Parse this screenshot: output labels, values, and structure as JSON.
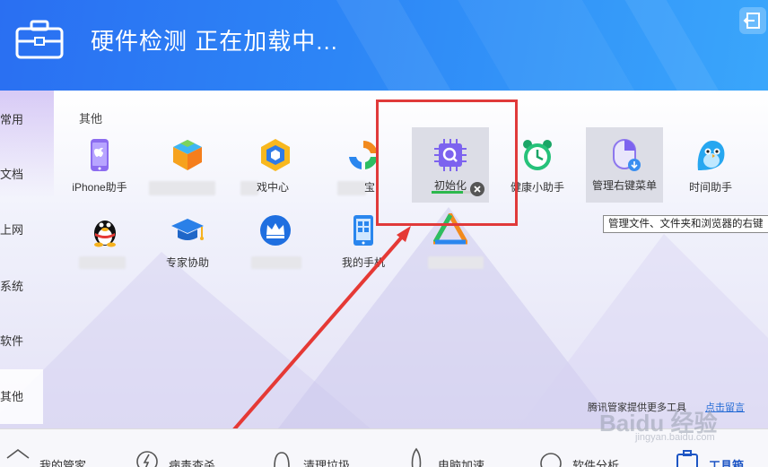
{
  "header": {
    "title": "硬件检测 正在加载中..."
  },
  "sidebar": {
    "items": [
      {
        "label": "常用"
      },
      {
        "label": "文档"
      },
      {
        "label": "上网"
      },
      {
        "label": "系统"
      },
      {
        "label": "软件"
      },
      {
        "label": "其他"
      }
    ]
  },
  "main": {
    "section_title": "其他",
    "tools": [
      {
        "label": "iPhone助手",
        "icon": "iphone-icon"
      },
      {
        "label": "",
        "icon": "cube-icon"
      },
      {
        "label": "戏中心",
        "icon": "game-center-icon"
      },
      {
        "label": "宝",
        "icon": "swirl-icon"
      },
      {
        "label": "初始化",
        "icon": "chip-search-icon",
        "progress": 0.75
      },
      {
        "label": "健康小助手",
        "icon": "alarm-clock-icon"
      },
      {
        "label": "管理右键菜单",
        "icon": "mouse-menu-icon"
      },
      {
        "label": "时间助手",
        "icon": "bird-icon"
      },
      {
        "label": "",
        "icon": "qq-penguin-icon"
      },
      {
        "label": "专家协助",
        "icon": "graduation-cap-icon"
      },
      {
        "label": "",
        "icon": "crown-icon"
      },
      {
        "label": "我的手机",
        "icon": "phone-icon"
      },
      {
        "label": "",
        "icon": "triangle-swirl-icon"
      }
    ],
    "tooltip": "管理文件、文件夹和浏览器的右键",
    "footer_note": "腾讯管家提供更多工具",
    "footer_link": "点击留言"
  },
  "bottom_tabs": [
    {
      "label": "我的管家",
      "icon": "home-shield-icon"
    },
    {
      "label": "病毒查杀",
      "icon": "lightning-shield-icon"
    },
    {
      "label": "清理垃圾",
      "icon": "broom-icon"
    },
    {
      "label": "电脑加速",
      "icon": "rocket-icon"
    },
    {
      "label": "软件分析",
      "icon": "app-icon"
    },
    {
      "label": "工具箱",
      "icon": "toolbox-icon",
      "active": true
    }
  ],
  "watermark": {
    "brand": "Baidu 经验",
    "url": "jingyan.baidu.com"
  },
  "colors": {
    "accent": "#2a6ff2",
    "highlight": "#e03a3a",
    "progress": "#2db84d"
  }
}
